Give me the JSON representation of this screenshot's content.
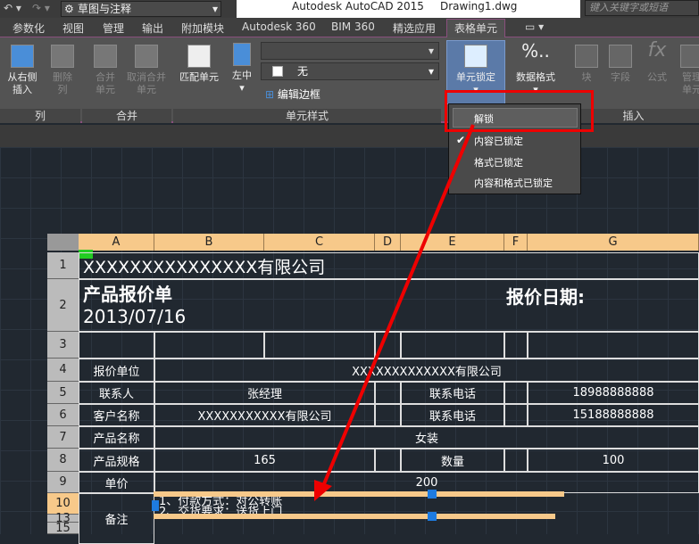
{
  "titlebar": {
    "workspace": "草图与注释",
    "title": "Autodesk AutoCAD 2015",
    "file": "Drawing1.dwg",
    "search_placeholder": "键入关键字或短语"
  },
  "tabs": [
    "参数化",
    "视图",
    "管理",
    "输出",
    "附加模块",
    "Autodesk 360",
    "BIM 360",
    "精选应用",
    "表格单元"
  ],
  "active_tab": "表格单元",
  "ribbon": {
    "col_panel": {
      "label": "列",
      "insert_right": "从右侧\n插入",
      "delete": "删除\n列"
    },
    "merge_panel": {
      "label": "合并",
      "merge": "合并\n单元",
      "unmerge": "取消合并\n单元"
    },
    "style_panel": {
      "label": "单元样式",
      "match": "匹配单元",
      "align": "左中",
      "fill": "无",
      "border": "编辑边框"
    },
    "lock": "单元锁定",
    "format": "数据格式",
    "insert_panel": {
      "label": "插入",
      "block": "块",
      "field": "字段",
      "formula": "公式",
      "manage": "管理单元"
    }
  },
  "lock_menu": {
    "items": [
      "解锁",
      "内容已锁定",
      "格式已锁定",
      "内容和格式已锁定"
    ],
    "checked": "内容已锁定",
    "highlighted": "解锁"
  },
  "table": {
    "columns": [
      "A",
      "B",
      "C",
      "D",
      "E",
      "F",
      "G"
    ],
    "rows": [
      "1",
      "2",
      "3",
      "4",
      "5",
      "6",
      "7",
      "8",
      "9",
      "10",
      "13",
      "15"
    ],
    "company": "XXXXXXXXXXXXXXX有限公司",
    "doc_title": "产品报价单",
    "doc_date": "2013/07/16",
    "date_label": "报价日期:",
    "r4": [
      "报价单位",
      "XXXXXXXXXXXXX有限公司"
    ],
    "r5": [
      "联系人",
      "张经理",
      "联系电话",
      "18988888888"
    ],
    "r6": [
      "客户名称",
      "XXXXXXXXXXX有限公司",
      "联系电话",
      "15188888888"
    ],
    "r7": [
      "产品名称",
      "女装"
    ],
    "r8": [
      "产品规格",
      "165",
      "数量",
      "100"
    ],
    "r9": [
      "单价",
      "200"
    ],
    "r10": [
      "备注",
      "1、付款方式：对公转账",
      "2、交货要求：送货上门"
    ]
  },
  "colors": {
    "accent_red": "#e00000",
    "header_orange": "#f7c98a",
    "selection_blue": "#1e7be0"
  }
}
